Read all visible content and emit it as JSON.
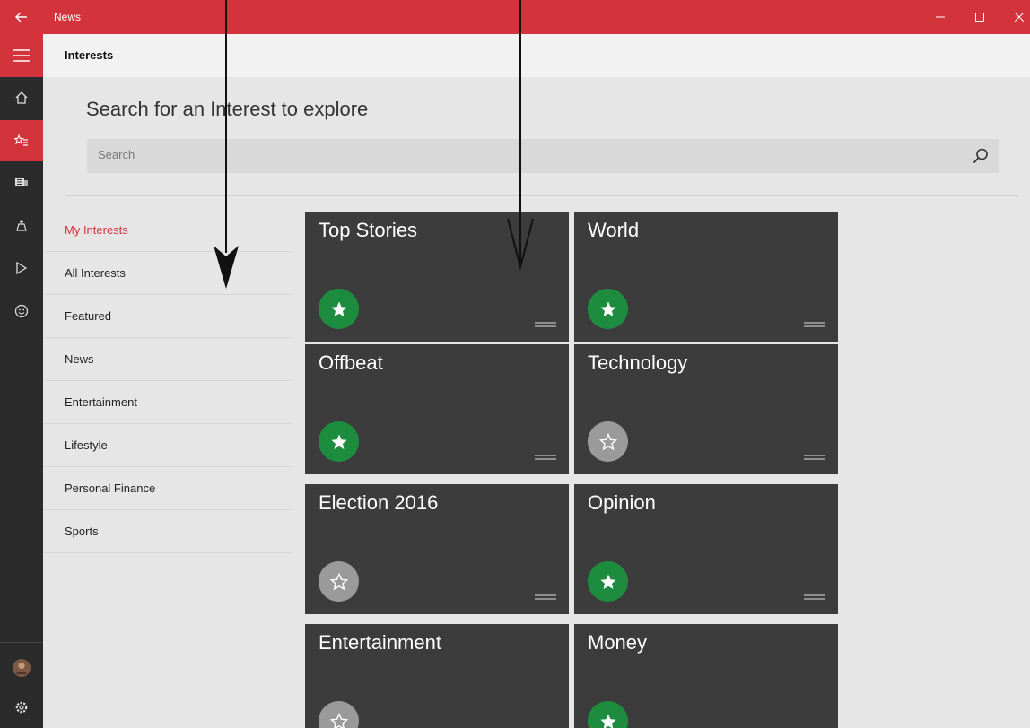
{
  "window": {
    "app_title": "News"
  },
  "header": {
    "page_title": "Interests"
  },
  "search": {
    "heading": "Search for an Interest to explore",
    "placeholder": "Search"
  },
  "categories": [
    {
      "label": "My Interests",
      "active": true
    },
    {
      "label": "All Interests"
    },
    {
      "label": "Featured"
    },
    {
      "label": "News"
    },
    {
      "label": "Entertainment"
    },
    {
      "label": "Lifestyle"
    },
    {
      "label": "Personal Finance"
    },
    {
      "label": "Sports"
    }
  ],
  "tiles": [
    {
      "title": "Top Stories",
      "followed": true
    },
    {
      "title": "World",
      "followed": true
    },
    {
      "title": "Offbeat",
      "followed": true
    },
    {
      "title": "Technology",
      "followed": false
    },
    {
      "title": "Election 2016",
      "followed": false
    },
    {
      "title": "Opinion",
      "followed": true
    },
    {
      "title": "Entertainment",
      "followed": false
    },
    {
      "title": "Money",
      "followed": true
    }
  ],
  "rail_icons": [
    "home-icon",
    "star-list-icon",
    "newspaper-icon",
    "local-icon",
    "video-icon",
    "smiley-icon",
    "avatar",
    "settings-icon"
  ],
  "colors": {
    "accent": "#d3333b",
    "rail": "#2b2b2b",
    "tile": "#3c3c3c",
    "followed": "#1e8c3f",
    "unfollowed": "#9a9a9a"
  }
}
